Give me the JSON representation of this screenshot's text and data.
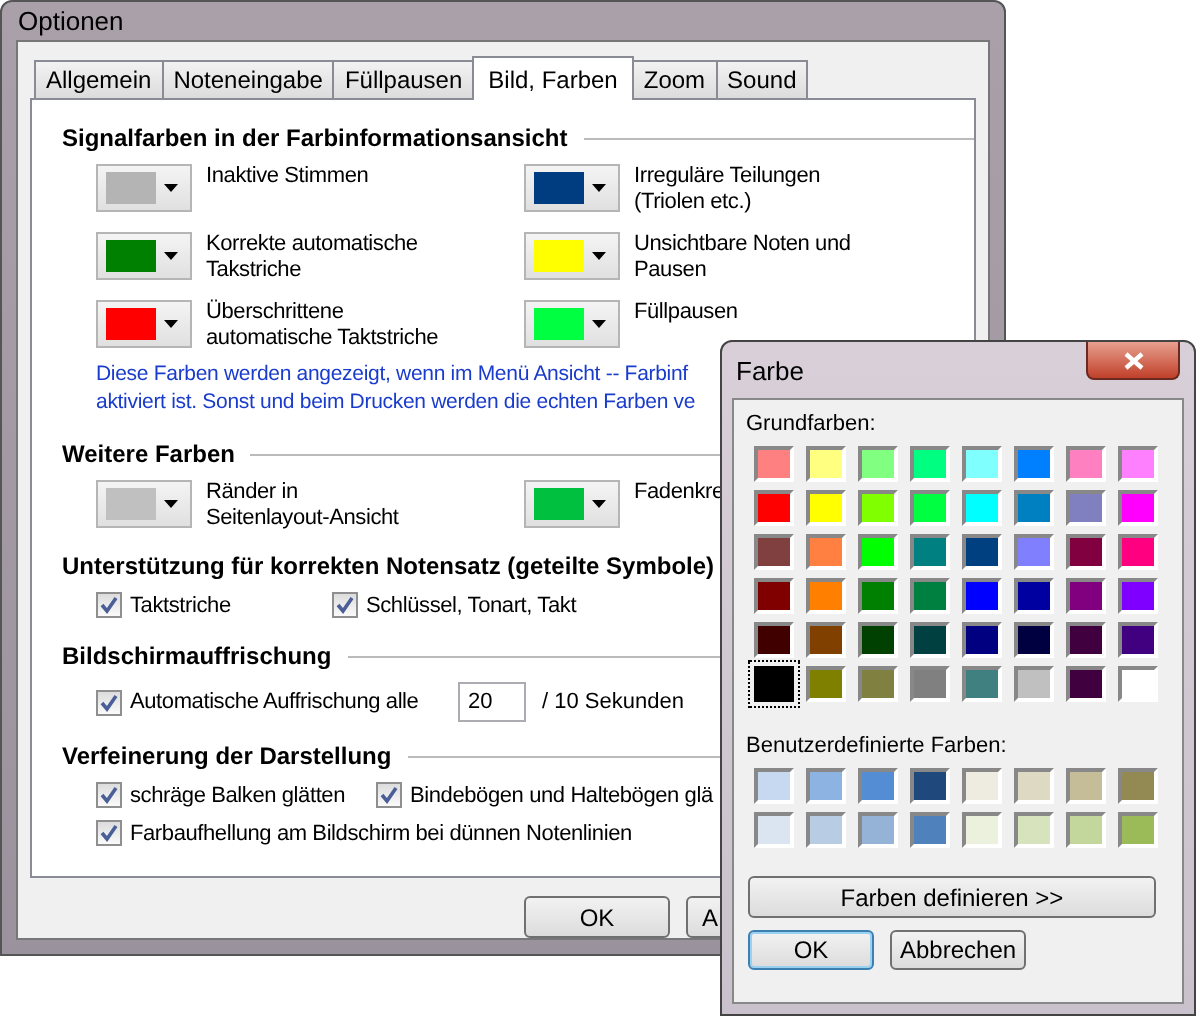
{
  "window": {
    "title": "Optionen"
  },
  "tabs": [
    {
      "label": "Allgemein",
      "selected": false
    },
    {
      "label": "Noteneingabe",
      "selected": false
    },
    {
      "label": "Füllpausen",
      "selected": false
    },
    {
      "label": "Bild, Farben",
      "selected": true
    },
    {
      "label": "Zoom",
      "selected": false
    },
    {
      "label": "Sound",
      "selected": false
    }
  ],
  "signal_colors": {
    "title": "Signalfarben in der Farbinformationsansicht",
    "items": [
      {
        "label": "Inaktive Stimmen",
        "color": "#b4b4b4"
      },
      {
        "label": "Irreguläre Teilungen\n(Triolen etc.)",
        "color": "#003c80"
      },
      {
        "label": "Korrekte automatische\nTakstriche",
        "color": "#008000"
      },
      {
        "label": "Unsichtbare Noten und\nPausen",
        "color": "#ffff00"
      },
      {
        "label": "Überschrittene\nautomatische Taktstriche",
        "color": "#ff0000"
      },
      {
        "label": "Füllpausen",
        "color": "#00ff40"
      }
    ],
    "note": [
      "Diese Farben werden angezeigt, wenn im  Menü  Ansicht -- Farbinf",
      "aktiviert ist. Sonst und beim Drucken werden die echten Farben ve"
    ]
  },
  "more_colors": {
    "title": "Weitere Farben",
    "items": [
      {
        "label": "Ränder in\nSeitenlayout-Ansicht",
        "color": "#c0c0c0"
      },
      {
        "label": "Fadenkre",
        "color": "#00c040"
      }
    ]
  },
  "engraving_support": {
    "title": "Unterstützung für korrekten Notensatz (geteilte Symbole)",
    "options": [
      {
        "label": "Taktstriche",
        "checked": true
      },
      {
        "label": "Schlüssel, Tonart, Takt",
        "checked": true
      }
    ]
  },
  "screen_refresh": {
    "title": "Bildschirmauffrischung",
    "option": {
      "label": "Automatische Auffrischung alle",
      "checked": true
    },
    "interval": "20",
    "unit": "/ 10 Sekunden"
  },
  "display_refinement": {
    "title": "Verfeinerung der Darstellung",
    "options": [
      {
        "label": "schräge Balken glätten",
        "checked": true
      },
      {
        "label": "Bindebögen und Haltebögen glä",
        "checked": true
      },
      {
        "label": "Farbaufhellung am Bildschirm bei dünnen Notenlinien",
        "checked": true
      }
    ]
  },
  "buttons": [
    "OK",
    "A"
  ],
  "color_dialog": {
    "title": "Farbe",
    "basic_label": "Grundfarben:",
    "basic_colors": [
      {
        "color": "#ff8080",
        "selected": false
      },
      {
        "color": "#ffff80",
        "selected": false
      },
      {
        "color": "#80ff80",
        "selected": false
      },
      {
        "color": "#00ff80",
        "selected": false
      },
      {
        "color": "#80ffff",
        "selected": false
      },
      {
        "color": "#0080ff",
        "selected": false
      },
      {
        "color": "#ff80c0",
        "selected": false
      },
      {
        "color": "#ff80ff",
        "selected": false
      },
      {
        "color": "#ff0000",
        "selected": false
      },
      {
        "color": "#ffff00",
        "selected": false
      },
      {
        "color": "#80ff00",
        "selected": false
      },
      {
        "color": "#00ff40",
        "selected": false
      },
      {
        "color": "#00ffff",
        "selected": false
      },
      {
        "color": "#0080c0",
        "selected": false
      },
      {
        "color": "#8080c0",
        "selected": false
      },
      {
        "color": "#ff00ff",
        "selected": false
      },
      {
        "color": "#804040",
        "selected": false
      },
      {
        "color": "#ff8040",
        "selected": false
      },
      {
        "color": "#00ff00",
        "selected": false
      },
      {
        "color": "#008080",
        "selected": false
      },
      {
        "color": "#004080",
        "selected": false
      },
      {
        "color": "#8080ff",
        "selected": false
      },
      {
        "color": "#800040",
        "selected": false
      },
      {
        "color": "#ff0080",
        "selected": false
      },
      {
        "color": "#800000",
        "selected": false
      },
      {
        "color": "#ff8000",
        "selected": false
      },
      {
        "color": "#008000",
        "selected": false
      },
      {
        "color": "#008040",
        "selected": false
      },
      {
        "color": "#0000ff",
        "selected": false
      },
      {
        "color": "#0000a0",
        "selected": false
      },
      {
        "color": "#800080",
        "selected": false
      },
      {
        "color": "#8000ff",
        "selected": false
      },
      {
        "color": "#400000",
        "selected": false
      },
      {
        "color": "#804000",
        "selected": false
      },
      {
        "color": "#004000",
        "selected": false
      },
      {
        "color": "#004040",
        "selected": false
      },
      {
        "color": "#000080",
        "selected": false
      },
      {
        "color": "#000040",
        "selected": false
      },
      {
        "color": "#400040",
        "selected": false
      },
      {
        "color": "#400080",
        "selected": false
      },
      {
        "color": "#000000",
        "selected": true
      },
      {
        "color": "#808000",
        "selected": false
      },
      {
        "color": "#808040",
        "selected": false
      },
      {
        "color": "#808080",
        "selected": false
      },
      {
        "color": "#408080",
        "selected": false
      },
      {
        "color": "#c0c0c0",
        "selected": false
      },
      {
        "color": "#400040",
        "selected": false
      },
      {
        "color": "#ffffff",
        "selected": false
      }
    ],
    "custom_label": "Benutzerdefinierte Farben:",
    "custom_colors": [
      {
        "color": "#c6d9f0",
        "selected": false
      },
      {
        "color": "#8db3e2",
        "selected": false
      },
      {
        "color": "#548dd4",
        "selected": false
      },
      {
        "color": "#1f497d",
        "selected": false
      },
      {
        "color": "#eeece1",
        "selected": false
      },
      {
        "color": "#ddd9c3",
        "selected": false
      },
      {
        "color": "#c4bd97",
        "selected": false
      },
      {
        "color": "#938953",
        "selected": false
      },
      {
        "color": "#dbe5f1",
        "selected": false
      },
      {
        "color": "#b8cce4",
        "selected": false
      },
      {
        "color": "#95b3d7",
        "selected": false
      },
      {
        "color": "#4f81bd",
        "selected": false
      },
      {
        "color": "#ebf1dd",
        "selected": false
      },
      {
        "color": "#d7e3bc",
        "selected": false
      },
      {
        "color": "#c3d69b",
        "selected": false
      },
      {
        "color": "#9bbb59",
        "selected": false
      }
    ],
    "define_button": "Farben definieren >>",
    "buttons": [
      "OK",
      "Abbrechen"
    ]
  }
}
